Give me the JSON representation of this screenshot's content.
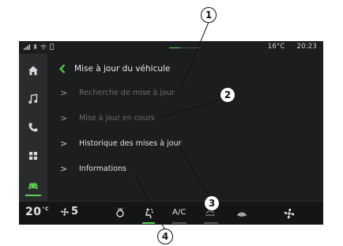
{
  "status": {
    "temperature": "16°C",
    "time": "20:23"
  },
  "sidebar": {
    "items": [
      {
        "icon": "home-icon"
      },
      {
        "icon": "music-icon"
      },
      {
        "icon": "phone-icon"
      },
      {
        "icon": "apps-grid-icon"
      },
      {
        "icon": "car-icon",
        "active": true
      }
    ]
  },
  "header": {
    "title": "Mise à jour du véhicule"
  },
  "menu": {
    "items": [
      {
        "label": "Recherche de mise à jour",
        "enabled": false
      },
      {
        "label": "Mise à jour en cours",
        "enabled": false
      },
      {
        "label": "Historique des mises à jour",
        "enabled": true
      },
      {
        "label": "Informations",
        "enabled": true
      }
    ]
  },
  "climate": {
    "temperature_value": "20",
    "temperature_unit": "°C",
    "fan_level": "5",
    "ac_label": "A/C"
  },
  "callouts": {
    "one": "1",
    "two": "2",
    "three": "3",
    "four": "4"
  },
  "colors": {
    "accent": "#5ad14f",
    "background": "#1c1d1f",
    "sidebar": "#2a2b2d"
  }
}
